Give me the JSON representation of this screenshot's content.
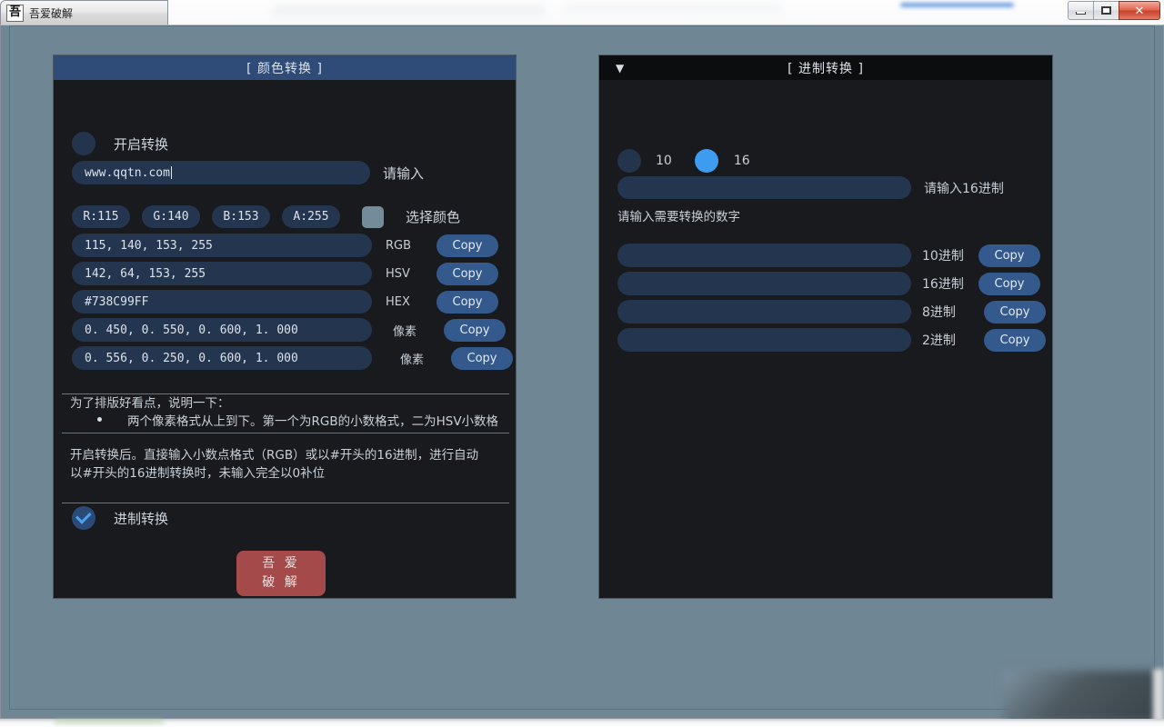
{
  "window": {
    "title": "吾爱破解",
    "icon": "吾",
    "icon_name": "app-icon",
    "controls": {
      "minimize": "minimize-icon",
      "maximize": "maximize-icon",
      "close": "✕"
    }
  },
  "color_panel": {
    "title": "[ 颜色转换 ]",
    "enable_toggle": {
      "label": "开启转换",
      "checked": false
    },
    "url_input": {
      "value": "www.qqtn.com",
      "side_label": "请输入"
    },
    "channels": [
      {
        "label": "R:115"
      },
      {
        "label": "G:140"
      },
      {
        "label": "B:153"
      },
      {
        "label": "A:255"
      }
    ],
    "swatch": {
      "color": "#738C99",
      "label": "选择颜色"
    },
    "value_rows": [
      {
        "value": "115, 140, 153, 255",
        "label": "RGB",
        "copy": "Copy"
      },
      {
        "value": "142, 64, 153, 255",
        "label": "HSV",
        "copy": "Copy"
      },
      {
        "value": "#738C99FF",
        "label": "HEX",
        "copy": "Copy"
      },
      {
        "value": "0. 450, 0. 550, 0. 600, 1. 000",
        "label": "像素",
        "copy": "Copy"
      },
      {
        "value": "0. 556, 0. 250, 0. 600, 1. 000",
        "label": "像素",
        "copy": "Copy"
      }
    ],
    "notes": {
      "heading": "为了排版好看点，说明一下：",
      "bullet": "两个像素格式从上到下。第一个为RGB的小数格式，二为HSV小数格",
      "line1": "开启转换后。直接输入小数点格式（RGB）或以#开头的16进制，进行自动",
      "line2": "以#开头的16进制转换时，未输入完全以0补位"
    },
    "base_toggle": {
      "label": "进制转换",
      "checked": true
    },
    "action_button": {
      "line1": "吾 爱",
      "line2": "破 解",
      "color": "#A44A4A"
    }
  },
  "base_panel": {
    "title": "[ 进制转换 ]",
    "collapse_icon": "▼",
    "radios": [
      {
        "label": "10",
        "selected": false
      },
      {
        "label": "16",
        "selected": true
      }
    ],
    "input": {
      "value": "",
      "side_label": "请输入16进制"
    },
    "hint": "请输入需要转换的数字",
    "result_rows": [
      {
        "value": "",
        "label": "10进制",
        "copy": "Copy"
      },
      {
        "value": "",
        "label": "16进制",
        "copy": "Copy"
      },
      {
        "value": "",
        "label": "8进制",
        "copy": "Copy"
      },
      {
        "value": "",
        "label": "2进制",
        "copy": "Copy"
      }
    ]
  },
  "theme": {
    "desktop": "#6F8694",
    "panel_bg": "#191A1D",
    "header_blue": "#2F4C79",
    "header_dark": "#0C0D0F",
    "accent_blue": "#3D9BF0",
    "field_blue": "#243550",
    "button_blue": "#34598C"
  }
}
